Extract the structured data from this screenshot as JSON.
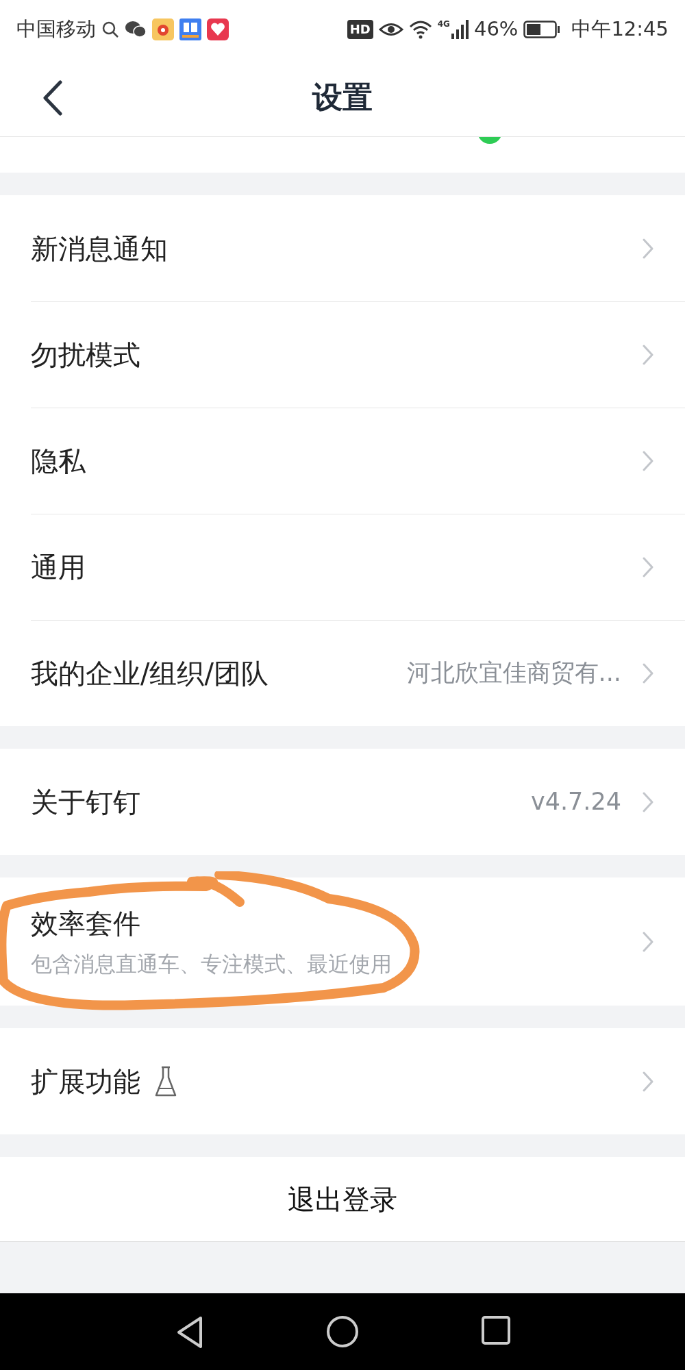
{
  "status_bar": {
    "carrier": "中国移动",
    "battery_percent": "46%",
    "network": "4G",
    "time": "中午12:45",
    "hd_badge": "HD"
  },
  "header": {
    "title": "设置"
  },
  "sections": [
    {
      "items": [
        {
          "kind": "plain",
          "label": "新消息通知"
        },
        {
          "kind": "plain",
          "label": "勿扰模式"
        },
        {
          "kind": "plain",
          "label": "隐私"
        },
        {
          "kind": "plain",
          "label": "通用"
        },
        {
          "kind": "plain",
          "label": "我的企业/组织/团队",
          "value": "河北欣宜佳商贸有..."
        }
      ]
    },
    {
      "items": [
        {
          "kind": "plain",
          "label": "关于钉钉",
          "value": "v4.7.24"
        }
      ]
    },
    {
      "items": [
        {
          "kind": "plain",
          "label": "效率套件",
          "subtitle": "包含消息直通车、专注模式、最近使用"
        }
      ]
    },
    {
      "items": [
        {
          "kind": "lab",
          "label": "扩展功能"
        }
      ]
    }
  ],
  "logout_button": {
    "label": "退出登录"
  },
  "annotation": {
    "kind": "circle"
  }
}
